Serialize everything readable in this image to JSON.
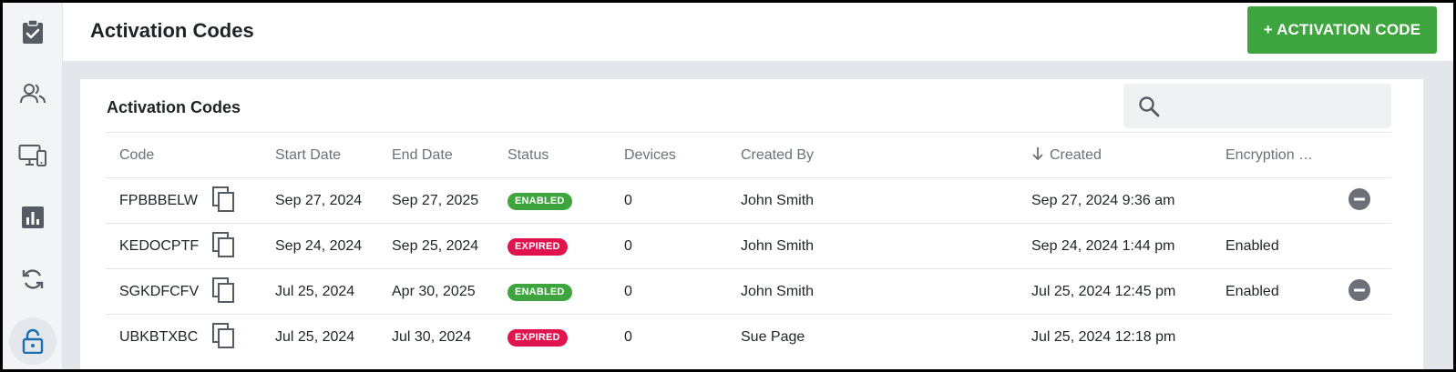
{
  "header": {
    "title": "Activation Codes",
    "add_button_label": "+ ACTIVATION CODE"
  },
  "sidebar": {
    "items": [
      {
        "icon": "clipboard-check-icon",
        "active": false
      },
      {
        "icon": "users-icon",
        "active": false
      },
      {
        "icon": "devices-icon",
        "active": false
      },
      {
        "icon": "bar-chart-icon",
        "active": false
      },
      {
        "icon": "sync-icon",
        "active": false
      },
      {
        "icon": "lock-icon",
        "active": true
      }
    ]
  },
  "card": {
    "title": "Activation Codes",
    "search_placeholder": ""
  },
  "table": {
    "columns": {
      "code": "Code",
      "start": "Start Date",
      "end": "End Date",
      "status": "Status",
      "devices": "Devices",
      "created_by": "Created By",
      "created": "Created",
      "encryption": "Encryption …"
    },
    "rows": [
      {
        "code": "FPBBBELW",
        "start": "Sep 27, 2024",
        "end": "Sep 27, 2025",
        "status": "ENABLED",
        "devices": "0",
        "created_by": "John Smith",
        "created": "Sep 27, 2024 9:36 am",
        "encryption": "",
        "removable": true
      },
      {
        "code": "KEDOCPTF",
        "start": "Sep 24, 2024",
        "end": "Sep 25, 2024",
        "status": "EXPIRED",
        "devices": "0",
        "created_by": "John Smith",
        "created": "Sep 24, 2024 1:44 pm",
        "encryption": "Enabled",
        "removable": false
      },
      {
        "code": "SGKDFCFV",
        "start": "Jul 25, 2024",
        "end": "Apr 30, 2025",
        "status": "ENABLED",
        "devices": "0",
        "created_by": "John Smith",
        "created": "Jul 25, 2024 12:45 pm",
        "encryption": "Enabled",
        "removable": true
      },
      {
        "code": "UBKBTXBC",
        "start": "Jul 25, 2024",
        "end": "Jul 30, 2024",
        "status": "EXPIRED",
        "devices": "0",
        "created_by": "Sue Page",
        "created": "Jul 25, 2024 12:18 pm",
        "encryption": "",
        "removable": false
      }
    ]
  },
  "colors": {
    "accent_green": "#3ea43d",
    "expired_red": "#e0134f",
    "active_icon": "#1a6fb0",
    "icon_gray": "#555b63"
  }
}
